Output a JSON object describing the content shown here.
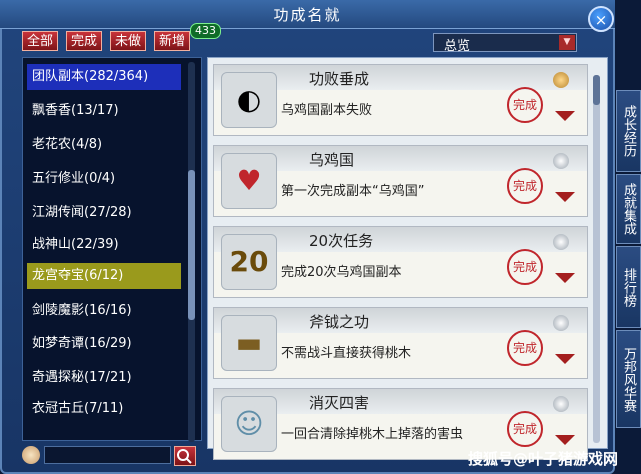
{
  "title": "功成名就",
  "close_label": "×",
  "filters": {
    "all": "全部",
    "done": "完成",
    "not_done": "未做",
    "new": "新增",
    "new_count": "433"
  },
  "dropdown": {
    "value": "总览"
  },
  "categories": [
    {
      "label": "团队副本(282/364)"
    },
    {
      "label": "飘香香(13/17)"
    },
    {
      "label": "老花农(4/8)"
    },
    {
      "label": "五行修业(0/4)"
    },
    {
      "label": "江湖传闻(27/28)"
    },
    {
      "label": "战神山(22/39)"
    },
    {
      "label": "龙宫夺宝(6/12)"
    },
    {
      "label": "剑陵魔影(16/16)"
    },
    {
      "label": "如梦奇谭(16/29)"
    },
    {
      "label": "奇遇探秘(17/21)"
    },
    {
      "label": "衣冠古丘(7/11)"
    }
  ],
  "achievements": [
    {
      "title": "功败垂成",
      "desc": "乌鸡国副本失败",
      "seal": "完成",
      "icon": "broken-jade-icon",
      "status_icon": "lock-icon"
    },
    {
      "title": "乌鸡国",
      "desc": "第一次完成副本“乌鸡国”",
      "seal": "完成",
      "icon": "heart-icon",
      "status_icon": "peach-icon"
    },
    {
      "title": "20次任务",
      "desc": "完成20次乌鸡国副本",
      "seal": "完成",
      "icon": "number-20-icon",
      "status_icon": "peach-icon",
      "icon_text": "20"
    },
    {
      "title": "斧钺之功",
      "desc": "不需战斗直接获得桃木",
      "seal": "完成",
      "icon": "wood-plank-icon",
      "status_icon": "peach-icon"
    },
    {
      "title": "消灭四害",
      "desc": "一回合清除掉桃木上掉落的害虫",
      "seal": "完成",
      "icon": "ghost-icon",
      "status_icon": "peach-icon"
    }
  ],
  "side_tabs": [
    {
      "label": "成长经历"
    },
    {
      "label": "成就集成"
    },
    {
      "label": "排行榜"
    },
    {
      "label": "万邦风华赛"
    }
  ],
  "watermark": "搜狐号@叶子猪游戏网",
  "colors": {
    "seal_red": "#c0262c",
    "selected_blue": "#1d2fba",
    "selected_olive": "#9a9a1c"
  }
}
